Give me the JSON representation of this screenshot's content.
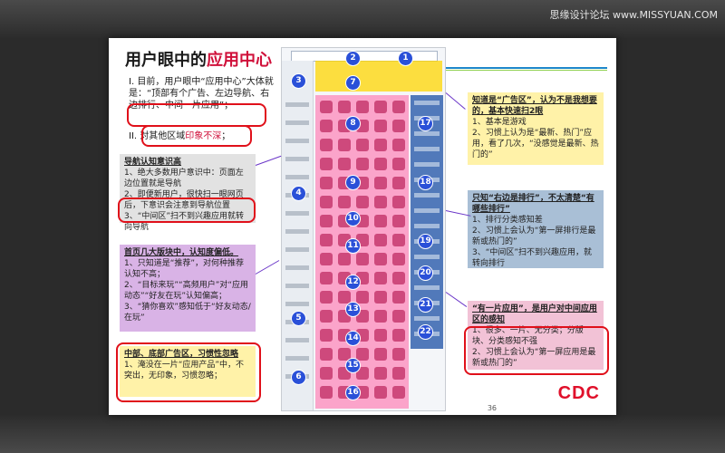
{
  "watermark": "思缘设计论坛 www.MISSYUAN.COM",
  "slide": {
    "title_prefix": "用户眼中的",
    "title_accent": "应用中心",
    "bullet1_num": "I.",
    "bullet1_text": "目前，用户眼中“应用中心”大体就是：“顶部有个广告、左边导航、右边排行、中间一片应用”；",
    "bullet2_num": "II.",
    "bullet2_text_a": "对其他区域",
    "bullet2_text_b": "印象不深",
    "bullet2_text_c": "；",
    "page_number": "36",
    "logo": "CDC"
  },
  "notes": {
    "nav": {
      "heading": "导航认知意识高",
      "lines": [
        "1、绝大多数用户意识中：页面左边位置就是导航",
        "2、即便新用户，很快扫一眼网页后，下意识会注意到导航位置",
        "3、“中间区”扫不到兴趣应用就转向导航"
      ]
    },
    "home": {
      "heading": "首页几大版块中，认知度偏低。",
      "lines": [
        "1、只知道是“推荐”，对何种推荐认知不高；",
        "2、“目标来玩”“高频用户”对“应用动态”“好友在玩”认知偏高；",
        "3、“猜你喜欢”感知低于“好友动态/在玩”"
      ]
    },
    "ad": {
      "heading": "中部、底部广告区，习惯性忽略",
      "lines": [
        "1、淹没在一片“应用产品”中，不突出，无印象，习惯忽略；"
      ]
    },
    "top": {
      "heading": "知道是“广告区”，认为不是我想要的，基本快速扫2眼",
      "lines": [
        "1、基本是游戏",
        "2、习惯上认为是“最新、热门”应用，看了几次，“没感觉是最新、热门的”"
      ]
    },
    "rank": {
      "heading": "只知“右边是排行”，不太清楚“有哪些排行”",
      "lines": [
        "1、排行分类感知差",
        "2、习惯上会认为“第一屏排行是最新或热门的”",
        "3、“中间区”扫不到兴趣应用，就转向排行"
      ]
    },
    "one": {
      "heading": "“有一片应用”，是用户对中间应用区的感知",
      "lines": [
        "1、很多、一片、无分类；分版块、分类感知不强",
        "2、习惯上会认为“第一屏应用是最新或热门的”"
      ]
    }
  },
  "markers": [
    "1",
    "2",
    "3",
    "4",
    "5",
    "6",
    "7",
    "8",
    "9",
    "10",
    "11",
    "12",
    "13",
    "14",
    "15",
    "16",
    "17",
    "18",
    "19",
    "20",
    "21",
    "22"
  ],
  "colors": {
    "accent_red": "#d0103a",
    "marker_blue": "#2a50d8",
    "zone_yellow": "#ffd600",
    "zone_pink": "#ff6eaa",
    "zone_blue": "#285aaa"
  }
}
